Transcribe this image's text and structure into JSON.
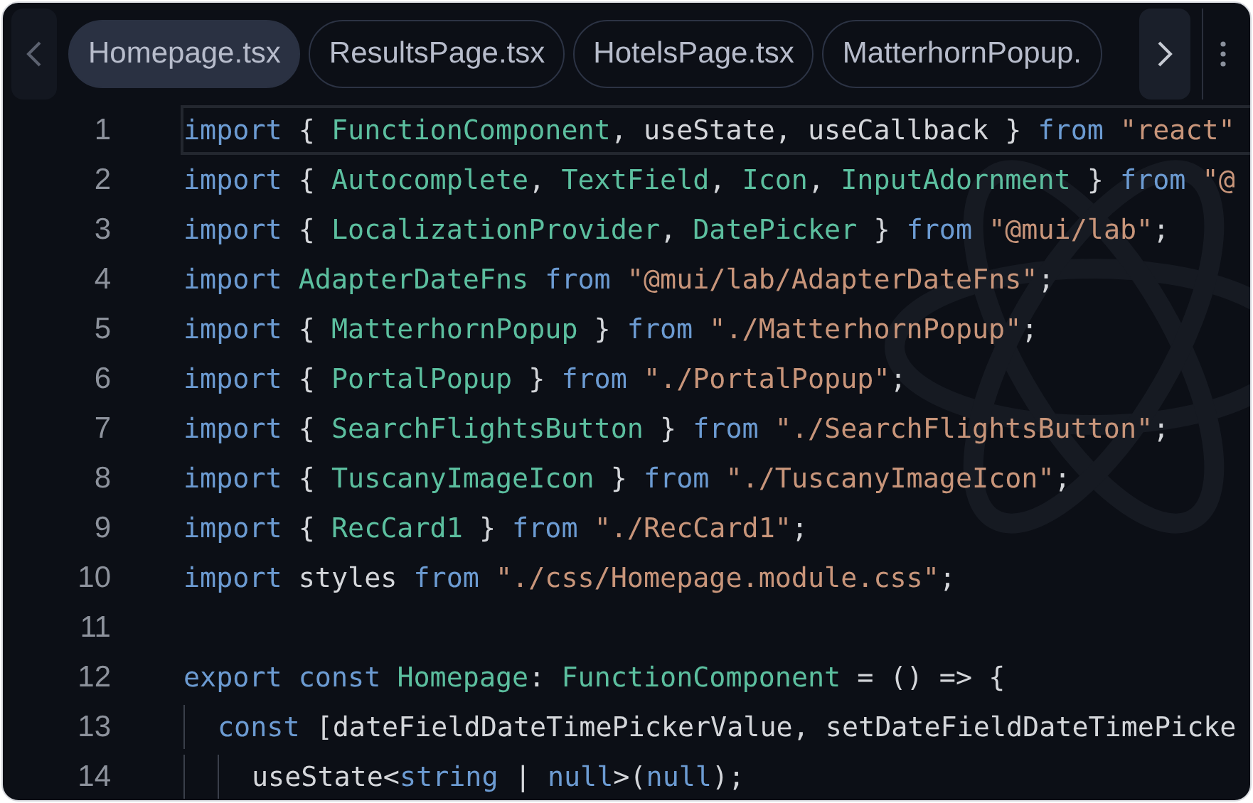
{
  "tabs": [
    {
      "label": "Homepage.tsx",
      "selected": true
    },
    {
      "label": "ResultsPage.tsx",
      "selected": false
    },
    {
      "label": "HotelsPage.tsx",
      "selected": false
    },
    {
      "label": "MatterhornPopup.",
      "selected": false
    }
  ],
  "code_lines": [
    {
      "number": "1",
      "current": true,
      "tokens": [
        {
          "kind": "keyword",
          "text": "import"
        },
        {
          "kind": "plain",
          "text": " { "
        },
        {
          "kind": "name",
          "text": "FunctionComponent"
        },
        {
          "kind": "plain",
          "text": ", useState, useCallback } "
        },
        {
          "kind": "keyword",
          "text": "from "
        },
        {
          "kind": "string",
          "text": "\"react\""
        }
      ]
    },
    {
      "number": "2",
      "current": false,
      "tokens": [
        {
          "kind": "keyword",
          "text": "import"
        },
        {
          "kind": "plain",
          "text": " { "
        },
        {
          "kind": "name",
          "text": "Autocomplete"
        },
        {
          "kind": "plain",
          "text": ", "
        },
        {
          "kind": "name",
          "text": "TextField"
        },
        {
          "kind": "plain",
          "text": ", "
        },
        {
          "kind": "name",
          "text": "Icon"
        },
        {
          "kind": "plain",
          "text": ", "
        },
        {
          "kind": "name",
          "text": "InputAdornment"
        },
        {
          "kind": "plain",
          "text": " } "
        },
        {
          "kind": "keyword",
          "text": "from "
        },
        {
          "kind": "string",
          "text": "\"@"
        }
      ]
    },
    {
      "number": "3",
      "current": false,
      "tokens": [
        {
          "kind": "keyword",
          "text": "import"
        },
        {
          "kind": "plain",
          "text": " { "
        },
        {
          "kind": "name",
          "text": "LocalizationProvider"
        },
        {
          "kind": "plain",
          "text": ", "
        },
        {
          "kind": "name",
          "text": "DatePicker"
        },
        {
          "kind": "plain",
          "text": " } "
        },
        {
          "kind": "keyword",
          "text": "from "
        },
        {
          "kind": "string",
          "text": "\"@mui/lab\""
        },
        {
          "kind": "plain",
          "text": ";"
        }
      ]
    },
    {
      "number": "4",
      "current": false,
      "tokens": [
        {
          "kind": "keyword",
          "text": "import "
        },
        {
          "kind": "name",
          "text": "AdapterDateFns "
        },
        {
          "kind": "keyword",
          "text": "from "
        },
        {
          "kind": "string",
          "text": "\"@mui/lab/AdapterDateFns\""
        },
        {
          "kind": "plain",
          "text": ";"
        }
      ]
    },
    {
      "number": "5",
      "current": false,
      "tokens": [
        {
          "kind": "keyword",
          "text": "import"
        },
        {
          "kind": "plain",
          "text": " { "
        },
        {
          "kind": "name",
          "text": "MatterhornPopup"
        },
        {
          "kind": "plain",
          "text": " } "
        },
        {
          "kind": "keyword",
          "text": "from "
        },
        {
          "kind": "string",
          "text": "\"./MatterhornPopup\""
        },
        {
          "kind": "plain",
          "text": ";"
        }
      ]
    },
    {
      "number": "6",
      "current": false,
      "tokens": [
        {
          "kind": "keyword",
          "text": "import"
        },
        {
          "kind": "plain",
          "text": " { "
        },
        {
          "kind": "name",
          "text": "PortalPopup"
        },
        {
          "kind": "plain",
          "text": " } "
        },
        {
          "kind": "keyword",
          "text": "from "
        },
        {
          "kind": "string",
          "text": "\"./PortalPopup\""
        },
        {
          "kind": "plain",
          "text": ";"
        }
      ]
    },
    {
      "number": "7",
      "current": false,
      "tokens": [
        {
          "kind": "keyword",
          "text": "import"
        },
        {
          "kind": "plain",
          "text": " { "
        },
        {
          "kind": "name",
          "text": "SearchFlightsButton"
        },
        {
          "kind": "plain",
          "text": " } "
        },
        {
          "kind": "keyword",
          "text": "from "
        },
        {
          "kind": "string",
          "text": "\"./SearchFlightsButton\""
        },
        {
          "kind": "plain",
          "text": ";"
        }
      ]
    },
    {
      "number": "8",
      "current": false,
      "tokens": [
        {
          "kind": "keyword",
          "text": "import"
        },
        {
          "kind": "plain",
          "text": " { "
        },
        {
          "kind": "name",
          "text": "TuscanyImageIcon"
        },
        {
          "kind": "plain",
          "text": " } "
        },
        {
          "kind": "keyword",
          "text": "from "
        },
        {
          "kind": "string",
          "text": "\"./TuscanyImageIcon\""
        },
        {
          "kind": "plain",
          "text": ";"
        }
      ]
    },
    {
      "number": "9",
      "current": false,
      "tokens": [
        {
          "kind": "keyword",
          "text": "import"
        },
        {
          "kind": "plain",
          "text": " { "
        },
        {
          "kind": "name",
          "text": "RecCard1"
        },
        {
          "kind": "plain",
          "text": " } "
        },
        {
          "kind": "keyword",
          "text": "from "
        },
        {
          "kind": "string",
          "text": "\"./RecCard1\""
        },
        {
          "kind": "plain",
          "text": ";"
        }
      ]
    },
    {
      "number": "10",
      "current": false,
      "tokens": [
        {
          "kind": "keyword",
          "text": "import"
        },
        {
          "kind": "plain",
          "text": " styles "
        },
        {
          "kind": "keyword",
          "text": "from "
        },
        {
          "kind": "string",
          "text": "\"./css/Homepage.module.css\""
        },
        {
          "kind": "plain",
          "text": ";"
        }
      ]
    },
    {
      "number": "11",
      "current": false
    },
    {
      "number": "12",
      "current": false,
      "tokens": [
        {
          "kind": "keyword",
          "text": "export const "
        },
        {
          "kind": "name",
          "text": "Homepage"
        },
        {
          "kind": "plain",
          "text": ": "
        },
        {
          "kind": "name",
          "text": "FunctionComponent"
        },
        {
          "kind": "plain",
          "text": " = () => {"
        }
      ],
      "children": [
        {
          "number": "13",
          "current": false,
          "tokens": [
            {
              "kind": "keyword",
              "text": "const"
            },
            {
              "kind": "plain",
              "text": " [dateFieldDateTimePickerValue, setDateFieldDateTimePicke"
            }
          ],
          "children": [
            {
              "number": "14",
              "current": false,
              "tokens": [
                {
                  "kind": "plain",
                  "text": "useState<"
                },
                {
                  "kind": "keyword",
                  "text": "string"
                },
                {
                  "kind": "plain",
                  "text": " | "
                },
                {
                  "kind": "keyword",
                  "text": "null"
                },
                {
                  "kind": "plain",
                  "text": ">("
                },
                {
                  "kind": "keyword",
                  "text": "null"
                },
                {
                  "kind": "plain",
                  "text": ");"
                }
              ]
            }
          ]
        }
      ]
    }
  ]
}
